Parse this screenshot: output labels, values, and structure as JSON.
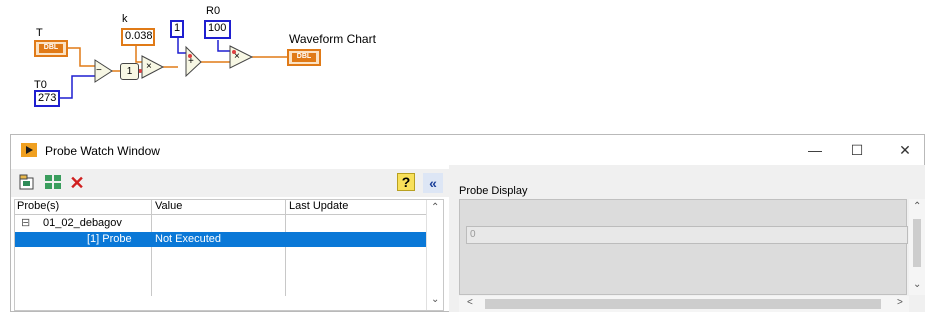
{
  "diagram": {
    "t_label": "T",
    "t0_label": "T0",
    "t0_value": "273",
    "k_label": "k",
    "k_value": "0.038",
    "one_value": "1",
    "constant_one_value": "1",
    "r0_label": "R0",
    "r0_value": "100",
    "chart_label": "Waveform Chart",
    "dbl_text": "DBL",
    "subtract_symbol": "−",
    "multiply_symbol": "×",
    "add_symbol": "+"
  },
  "window": {
    "title": "Probe Watch Window",
    "minimize": "—",
    "maximize": "☐",
    "close": "✕",
    "help_icon": "?",
    "collapse_icon": "«",
    "columns": [
      "Probe(s)",
      "Value",
      "Last Update"
    ],
    "tree_toggle": "⊟",
    "vi_name": "01_02_debagov",
    "probe_name": "[1] Probe",
    "probe_value": "Not Executed",
    "probe_display_label": "Probe Display",
    "display_value": "0"
  },
  "colors": {
    "accent": "#0a78d7",
    "double_wire": "#e07a17",
    "int_wire": "#1f1fd0"
  }
}
